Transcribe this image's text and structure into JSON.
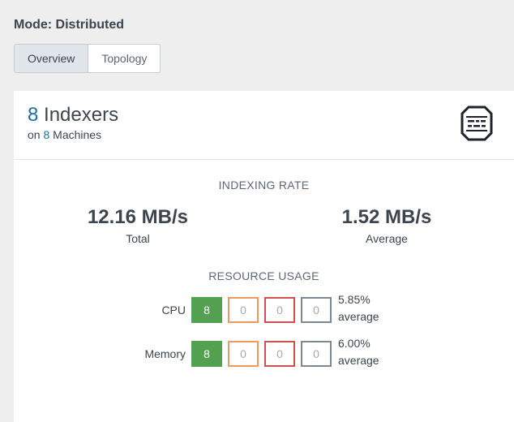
{
  "mode_label": "Mode: Distributed",
  "tabs": [
    {
      "label": "Overview",
      "active": true
    },
    {
      "label": "Topology",
      "active": false
    }
  ],
  "panel": {
    "count": "8",
    "title": "Indexers",
    "sub_prefix": "on",
    "machines": "8",
    "sub_suffix": "Machines",
    "icon": "server-icon"
  },
  "indexing_rate": {
    "title": "INDEXING RATE",
    "total_value": "12.16 MB/s",
    "total_label": "Total",
    "average_value": "1.52 MB/s",
    "average_label": "Average"
  },
  "resource_usage": {
    "title": "RESOURCE USAGE",
    "rows": [
      {
        "label": "CPU",
        "buckets": [
          "8",
          "0",
          "0",
          "0"
        ],
        "pct": "5.85%",
        "avg_label": "average"
      },
      {
        "label": "Memory",
        "buckets": [
          "8",
          "0",
          "0",
          "0"
        ],
        "pct": "6.00%",
        "avg_label": "average"
      }
    ],
    "colors": {
      "green": "#53a051",
      "orange": "#ec9960",
      "red": "#d1504d",
      "gray": "#7d8792"
    }
  }
}
